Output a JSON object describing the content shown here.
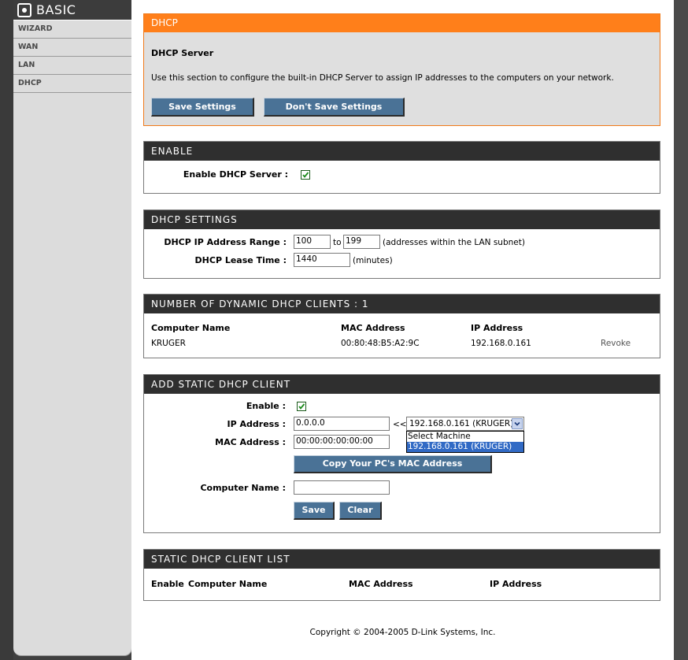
{
  "sidebar": {
    "title": "BASIC",
    "items": [
      {
        "label": "WIZARD"
      },
      {
        "label": "WAN"
      },
      {
        "label": "LAN"
      },
      {
        "label": "DHCP"
      }
    ]
  },
  "dhcp": {
    "header": "DHCP",
    "subtitle": "DHCP Server",
    "description": "Use this section to configure the built-in DHCP Server to assign IP addresses to the computers on your network.",
    "save_label": "Save Settings",
    "dont_save_label": "Don't Save Settings"
  },
  "enable": {
    "header": "ENABLE",
    "label": "Enable DHCP Server :",
    "checked": true
  },
  "settings": {
    "header": "DHCP SETTINGS",
    "range_label": "DHCP IP Address Range :",
    "range_start": "100",
    "range_to": "to",
    "range_end": "199",
    "range_note": "(addresses within the LAN subnet)",
    "lease_label": "DHCP Lease Time :",
    "lease_value": "1440",
    "lease_unit": "(minutes)"
  },
  "dynamic": {
    "header": "NUMBER OF DYNAMIC DHCP CLIENTS : 1",
    "columns": [
      "Computer Name",
      "MAC Address",
      "IP Address"
    ],
    "rows": [
      {
        "name": "KRUGER",
        "mac": "00:80:48:B5:A2:9C",
        "ip": "192.168.0.161",
        "action": "Revoke"
      }
    ]
  },
  "static_add": {
    "header": "ADD STATIC DHCP CLIENT",
    "enable_label": "Enable :",
    "enable_checked": true,
    "ip_label": "IP Address :",
    "ip_value": "0.0.0.0",
    "arrow": "<<",
    "machine_selected": "192.168.0.161 (KRUGER)",
    "machine_options": [
      "Select Machine",
      "192.168.0.161 (KRUGER)"
    ],
    "mac_label": "MAC Address :",
    "mac_value": "00:00:00:00:00:00",
    "copy_mac_label": "Copy Your PC's MAC Address",
    "name_label": "Computer Name :",
    "name_value": "",
    "save_label": "Save",
    "clear_label": "Clear"
  },
  "static_list": {
    "header": "STATIC DHCP CLIENT LIST",
    "columns": [
      "Enable",
      "Computer Name",
      "MAC Address",
      "IP Address"
    ]
  },
  "footer": {
    "copyright": "Copyright © 2004-2005 D-Link Systems, Inc."
  },
  "colors": {
    "accent_orange": "#ff7f1a",
    "header_dark": "#2f2f2f",
    "button_blue": "#4a7296",
    "sidebar_bg": "#dcdcdc"
  }
}
